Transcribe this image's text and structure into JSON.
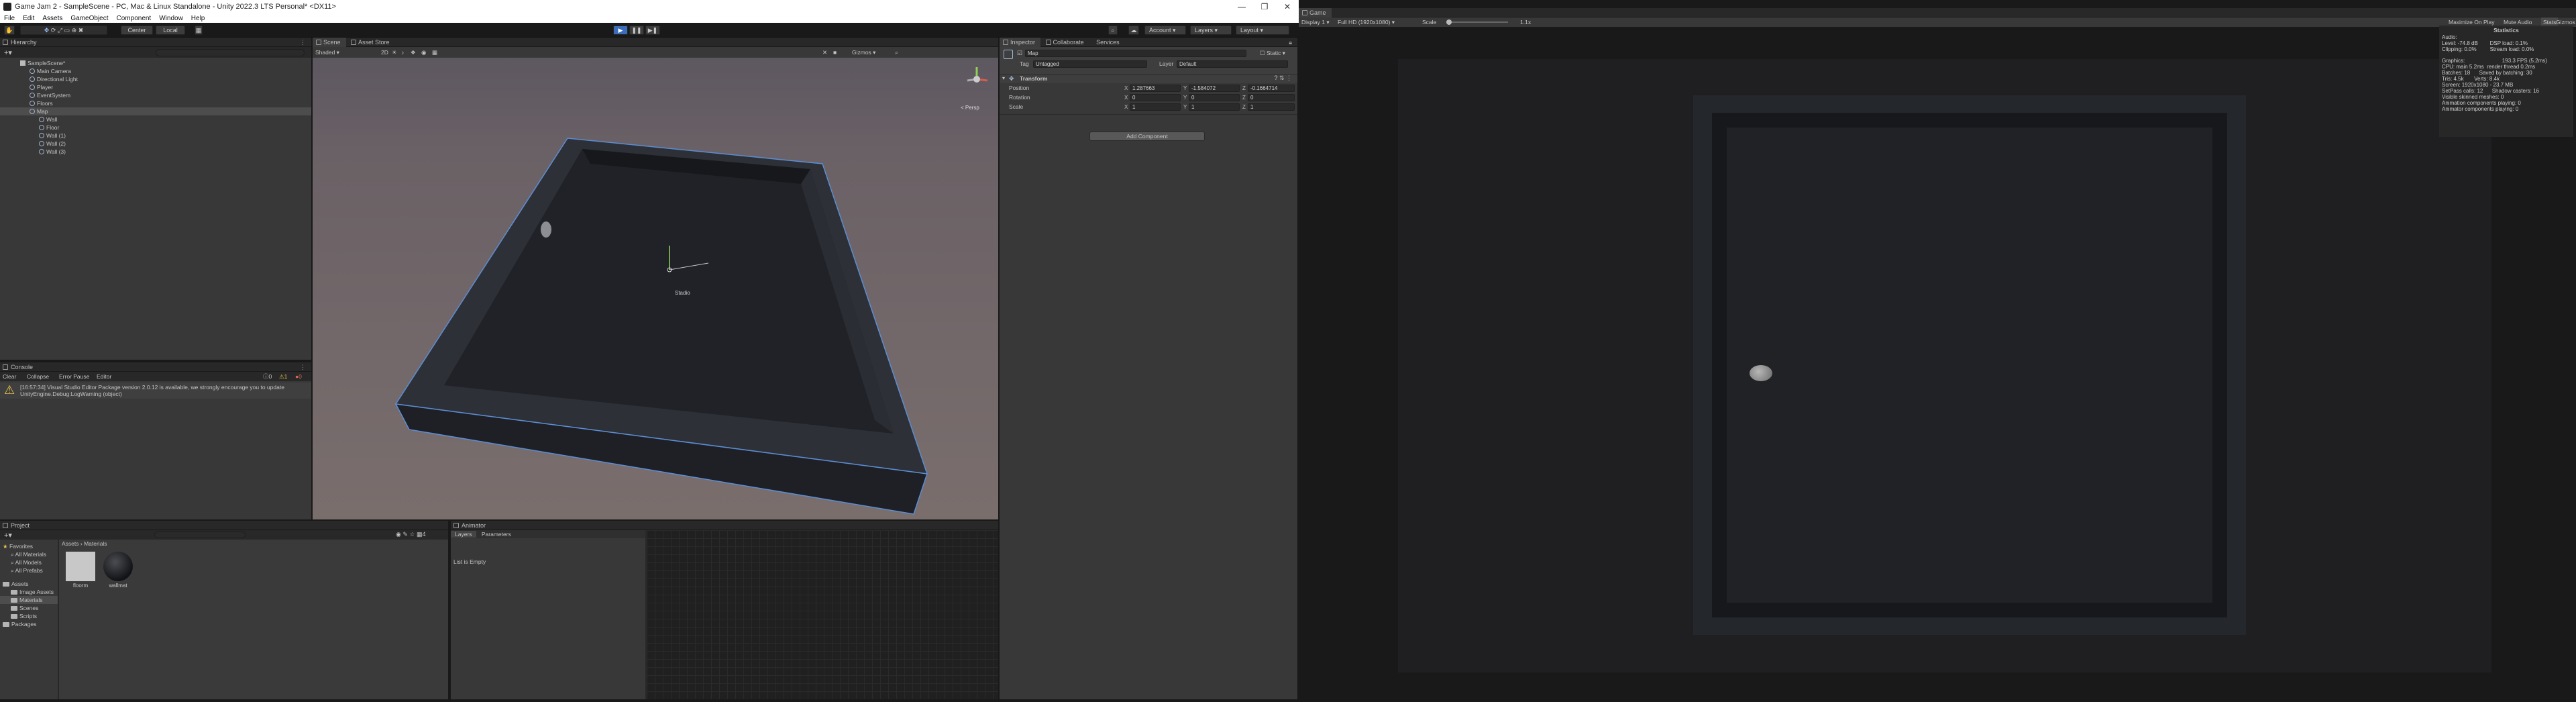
{
  "window": {
    "title": "Game Jam 2 - SampleScene - PC, Mac & Linux Standalone - Unity 2022.3 LTS Personal* <DX11>",
    "controls": [
      "—",
      "❐",
      "✕"
    ]
  },
  "menubar": [
    "File",
    "Edit",
    "Assets",
    "GameObject",
    "Component",
    "Window",
    "Help"
  ],
  "toolbar": {
    "center": "Center",
    "local": "Local",
    "play": "▶",
    "pause": "❚❚",
    "step": "▶❚",
    "account": "Account",
    "layers": "Layers",
    "layout": "Layout"
  },
  "hierarchy": {
    "tab": "Hierarchy",
    "items": [
      {
        "label": "SampleScene*",
        "depth": 0
      },
      {
        "label": "Main Camera",
        "depth": 1
      },
      {
        "label": "Directional Light",
        "depth": 1
      },
      {
        "label": "Player",
        "depth": 1
      },
      {
        "label": "EventSystem",
        "depth": 1
      },
      {
        "label": "Floors",
        "depth": 1
      },
      {
        "label": "Map",
        "depth": 1
      },
      {
        "label": "Wall",
        "depth": 2
      },
      {
        "label": "Floor",
        "depth": 2
      },
      {
        "label": "Wall (1)",
        "depth": 2
      },
      {
        "label": "Wall (2)",
        "depth": 2
      },
      {
        "label": "Wall (3)",
        "depth": 2
      }
    ]
  },
  "scene": {
    "tabs": [
      "Scene",
      "Asset Store"
    ],
    "shading": "Shaded",
    "toggle_2d": "2D",
    "gizmos": "Gizmos",
    "persp": "< Persp",
    "pivot_label": "Stadio"
  },
  "console": {
    "tab": "Console",
    "clear": "Clear",
    "collapse": "Collapse",
    "error_pause": "Error Pause",
    "editor": "Editor",
    "counts": [
      "0",
      "1",
      "0"
    ],
    "message_line1": "[16:57:34] Visual Studio Editor Package version 2.0.12 is available, we strongly encourage you to update",
    "message_line2": "UnityEngine.Debug:LogWarning (object)"
  },
  "project": {
    "tab": "Project",
    "favorites_label": "Favorites",
    "favorites": [
      "All Materials",
      "All Models",
      "All Prefabs"
    ],
    "assets_label": "Assets",
    "assets": [
      "Image Assets",
      "Materials",
      "Scenes",
      "Scripts"
    ],
    "packages_label": "Packages",
    "breadcrumb": [
      "Assets",
      "Materials"
    ],
    "files": [
      "floorm",
      "wallmat"
    ]
  },
  "animator": {
    "tab": "Animator",
    "subtabs": [
      "Layers",
      "Parameters"
    ],
    "empty": "List is Empty"
  },
  "inspector": {
    "tabs": [
      "Inspector",
      "Collaborate",
      "Services"
    ],
    "name": "Map",
    "static": "Static",
    "tag_label": "Tag",
    "tag": "Untagged",
    "layer_label": "Layer",
    "layer": "Default",
    "component": "Transform",
    "position_label": "Position",
    "rotation_label": "Rotation",
    "scale_label": "Scale",
    "position": {
      "x": "1.287663",
      "y": "-1.584072",
      "z": "-0.1664714"
    },
    "rotation": {
      "x": "0",
      "y": "0",
      "z": "0"
    },
    "scale": {
      "x": "1",
      "y": "1",
      "z": "1"
    },
    "add_component": "Add Component"
  },
  "game": {
    "tab": "Game",
    "display": "Display 1",
    "resolution": "Full HD (1920x1080)",
    "scale_label": "Scale",
    "scale_value": "1.1x",
    "maximize": "Maximize On Play",
    "mute": "Mute Audio",
    "stats_btn": "Stats",
    "gizmos": "Gizmos"
  },
  "stats": {
    "title": "Statistics",
    "lines": [
      "Audio:",
      "Level: -74.8 dB        DSP load: 0.1%",
      "Clipping: 0.0%         Stream load: 0.0%",
      "",
      "Graphics:                         193.3 FPS (5.2ms)",
      "CPU: main 5.2ms  render thread 0.2ms",
      "Batches: 18      Saved by batching: 30",
      "Tris: 4.5k       Verts: 8.4k",
      "Screen: 1920x1080 - 23.7 MB",
      "SetPass calls: 12      Shadow casters: 16",
      "Visible skinned meshes: 0",
      "Animation components playing: 0",
      "Animator components playing: 0"
    ]
  }
}
